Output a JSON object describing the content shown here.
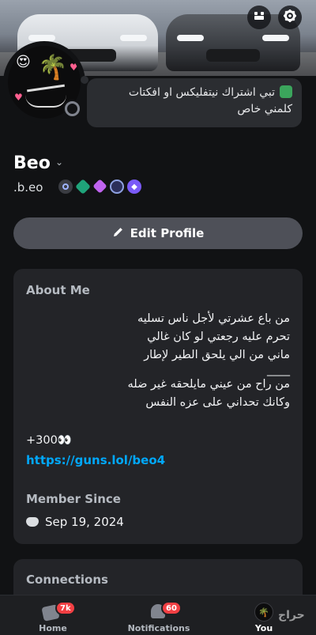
{
  "profile": {
    "display_name": "Beo",
    "username": ".b.eo",
    "custom_status": [
      "تبي اشتراك نيتفليكس او افكتات",
      "كلمني خاص"
    ]
  },
  "actions": {
    "edit_profile": "Edit Profile"
  },
  "about": {
    "title": "About Me",
    "bio_lines": [
      "من باع عشرتي لأجل ناس تسليه",
      "تحرم عليه رجعتي لو كان غالي",
      "ماني من الي يلحق الطير لإطار",
      "____",
      "من راح من عيني مايلحقه غير ضله",
      "وكانك تحداني على عزه النفس"
    ],
    "count_line": "+300👀",
    "link": "https://guns.lol/beo4",
    "member_since_title": "Member Since",
    "member_since_date": "Sep 19, 2024"
  },
  "connections": {
    "title": "Connections"
  },
  "nav": {
    "home_label": "Home",
    "home_badge": "7k",
    "notifications_label": "Notifications",
    "notifications_badge": "60",
    "you_label": "You"
  },
  "watermark": "حراج",
  "icons": {
    "nitro": "nitro-icon",
    "settings": "gear-icon",
    "edit": "pencil-icon",
    "discord": "discord-icon"
  },
  "colors": {
    "background": "#111214",
    "card": "#232428",
    "link": "#00a8fc",
    "badge_red": "#f23f43",
    "button": "#4e5058"
  }
}
